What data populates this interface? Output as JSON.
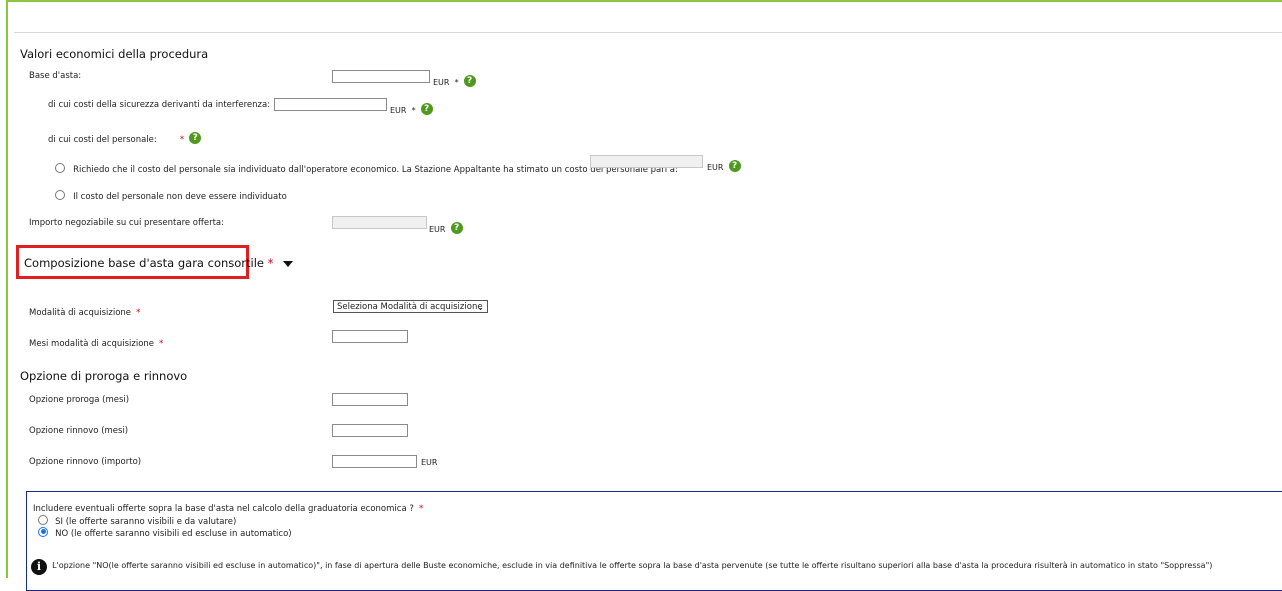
{
  "economic": {
    "title": "Valori economici della procedura",
    "base_asta_label": "Base d'asta:",
    "base_asta_unit": "EUR",
    "sicurezza_label": "di cui costi della sicurezza derivanti da interferenza:",
    "sicurezza_unit": "EUR",
    "personale_label": "di cui costi del personale:",
    "radio_individuato_label": "Richiedo che il costo del personale sia individuato dall'operatore economico. La Stazione Appaltante ha stimato un costo del personale pari a:",
    "radio_individuato_unit": "EUR",
    "radio_non_individuato_label": "Il costo del personale non deve essere individuato",
    "negoziabile_label": "Importo negoziabile su cui presentare offerta:",
    "negoziabile_unit": "EUR",
    "required_mark": "*",
    "help_glyph": "?"
  },
  "consortile": {
    "title": "Composizione base d'asta gara consortile",
    "required_mark": "*",
    "modalita_label": "Modalità di acquisizione",
    "modalita_selected": "Seleziona Modalità di acquisizione",
    "mesi_label": "Mesi modalità di acquisizione"
  },
  "proroga": {
    "title": "Opzione di proroga e rinnovo",
    "proroga_label": "Opzione proroga (mesi)",
    "rinnovo_label": "Opzione rinnovo (mesi)",
    "rinnovo_importo_label": "Opzione rinnovo (importo)",
    "rinnovo_importo_unit": "EUR"
  },
  "offerte": {
    "question": "Includere eventuali offerte sopra la base d'asta nel calcolo della graduatoria economica ?",
    "required_mark": "*",
    "option_si": "SI (le offerte saranno visibili e da valutare)",
    "option_no": "NO (le offerte saranno visibili ed escluse in automatico)",
    "selected": "NO",
    "info_glyph": "i",
    "info_text": "L'opzione \"NO(le offerte saranno visibili ed escluse in automatico)\", in fase di apertura delle Buste economiche, esclude in via definitiva le offerte sopra la base d'asta pervenute (se tutte le offerte risultano superiori alla base d'asta la procedura risulterà in automatico in stato \"Soppressa\")"
  },
  "colors": {
    "frame_border": "#8cc63f",
    "help_icon": "#4f9a1e",
    "highlight_box": "#e0201f",
    "required": "#d0021b",
    "bottom_box_border": "#1b2a8c"
  }
}
